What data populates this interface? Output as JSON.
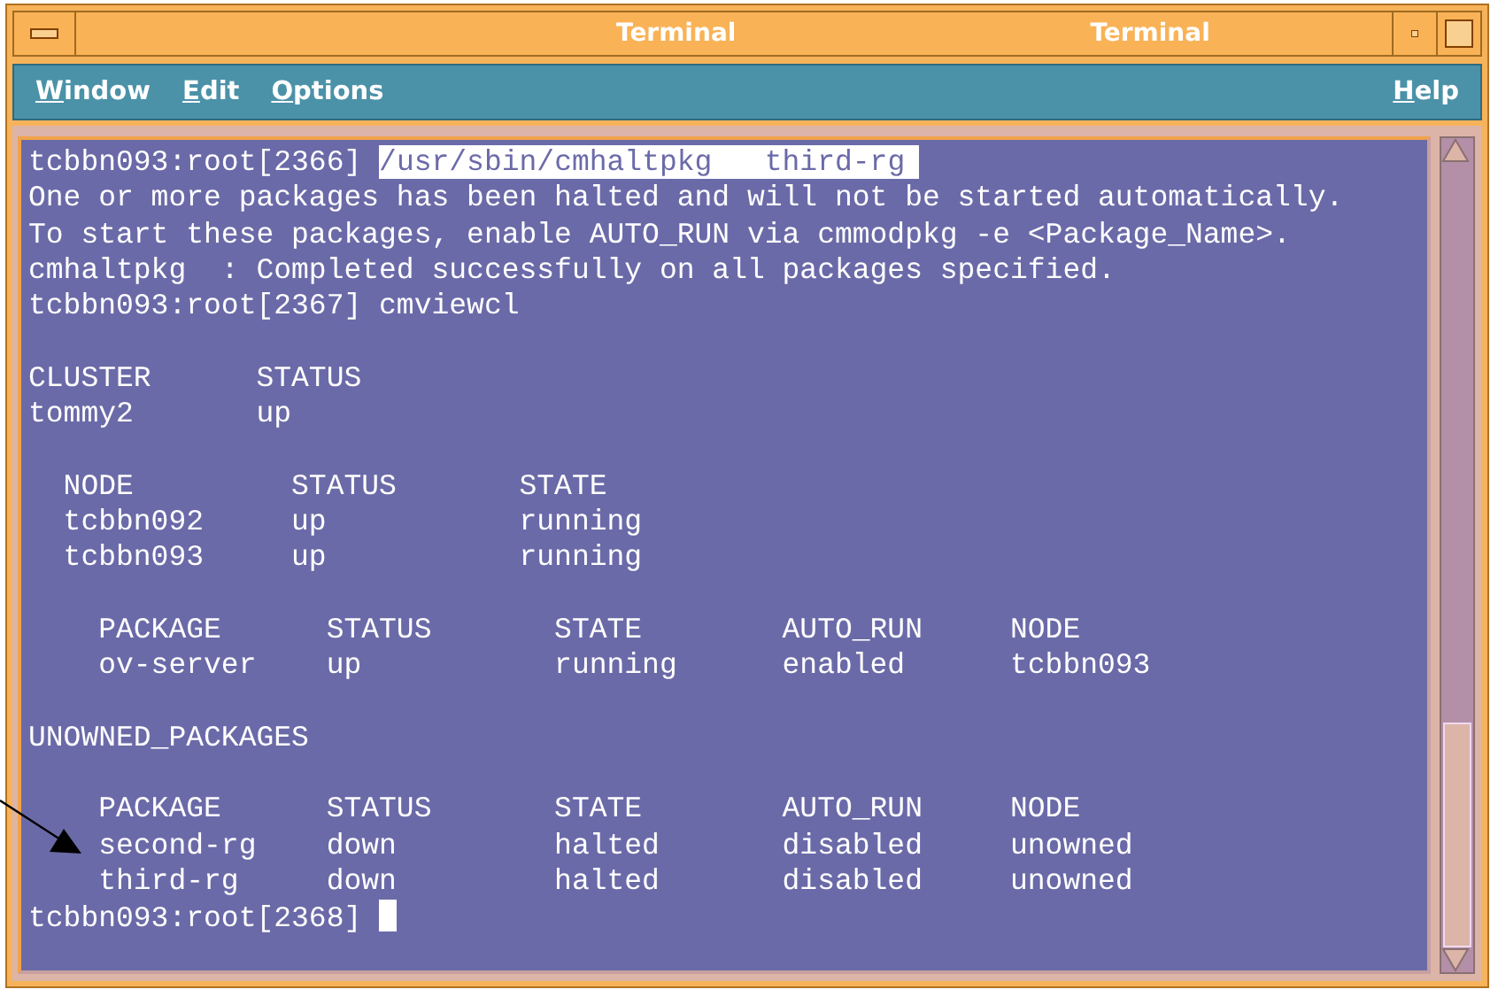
{
  "window": {
    "title": "Terminal",
    "title_secondary": "Terminal"
  },
  "menu": {
    "left": [
      "Window",
      "Edit",
      "Options"
    ],
    "right": [
      "Help"
    ]
  },
  "terminal": {
    "blocks": [
      {
        "lines": [
          {
            "text": "tcbbn093:root[2366] ",
            "selection": "/usr/sbin/cmhaltpkg   third-rg"
          },
          {
            "text": "One or more packages has been halted and will not be started automatically."
          },
          {
            "text": "To start these packages, enable AUTO_RUN via cmmodpkg -e <Package_Name>."
          },
          {
            "text": "cmhaltpkg  : Completed successfully on all packages specified."
          },
          {
            "text": "tcbbn093:root[2367] cmviewcl"
          }
        ]
      },
      {
        "lines": [
          {
            "text": "CLUSTER      STATUS"
          },
          {
            "text": "tommy2       up"
          }
        ]
      },
      {
        "lines": [
          {
            "text": "  NODE         STATUS       STATE"
          },
          {
            "text": "  tcbbn092     up           running"
          },
          {
            "text": "  tcbbn093     up           running"
          }
        ]
      },
      {
        "lines": [
          {
            "text": "    PACKAGE      STATUS       STATE        AUTO_RUN     NODE"
          },
          {
            "text": "    ov-server    up           running      enabled      tcbbn093"
          }
        ]
      },
      {
        "lines": [
          {
            "text": "UNOWNED_PACKAGES"
          }
        ]
      },
      {
        "lines": [
          {
            "text": "    PACKAGE      STATUS       STATE        AUTO_RUN     NODE"
          },
          {
            "text": "    second-rg    down         halted       disabled     unowned"
          },
          {
            "text": "    third-rg     down         halted       disabled     unowned"
          },
          {
            "text": "tcbbn093:root[2368] ",
            "cursor": true
          }
        ]
      }
    ]
  }
}
